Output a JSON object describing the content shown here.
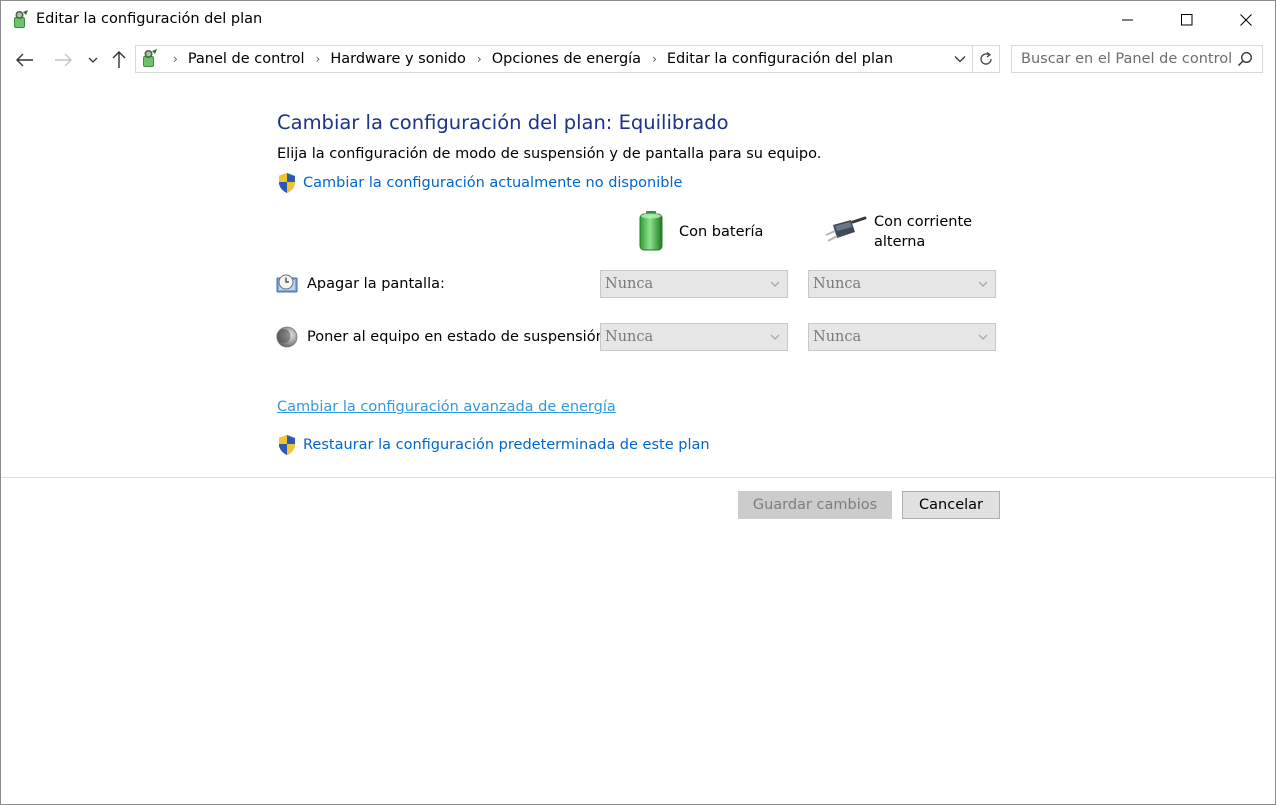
{
  "window": {
    "title": "Editar la configuración del plan"
  },
  "navigation": {
    "breadcrumbs": [
      "Panel de control",
      "Hardware y sonido",
      "Opciones de energía",
      "Editar la configuración del plan"
    ],
    "breadcrumb_separator": "›",
    "search_placeholder": "Buscar en el Panel de control"
  },
  "main": {
    "heading": "Cambiar la configuración del plan: Equilibrado",
    "description": "Elija la configuración de modo de suspensión y de pantalla para su equipo.",
    "change_unavailable_link": "Cambiar la configuración actualmente no disponible",
    "columns": {
      "battery": "Con batería",
      "ac_line1": "Con corriente",
      "ac_line2": "alterna"
    },
    "rows": [
      {
        "label": "Apagar la pantalla:",
        "battery_value": "Nunca",
        "ac_value": "Nunca"
      },
      {
        "label": "Poner al equipo en estado de suspensión:",
        "battery_value": "Nunca",
        "ac_value": "Nunca"
      }
    ],
    "advanced_link": "Cambiar la configuración avanzada de energía",
    "restore_link": "Restaurar la configuración predeterminada de este plan"
  },
  "footer": {
    "save_label": "Guardar cambios",
    "cancel_label": "Cancelar"
  },
  "icons": {
    "app": "power-options-icon",
    "shield": "uac-shield-icon",
    "battery": "battery-icon",
    "plug": "ac-plug-icon",
    "display": "display-clock-icon",
    "sleep": "moon-sleep-icon"
  },
  "colors": {
    "heading": "#1e3287",
    "link": "#0066cc",
    "link_advanced": "#3399dd",
    "disabled_select_bg": "#e6e6e6"
  }
}
